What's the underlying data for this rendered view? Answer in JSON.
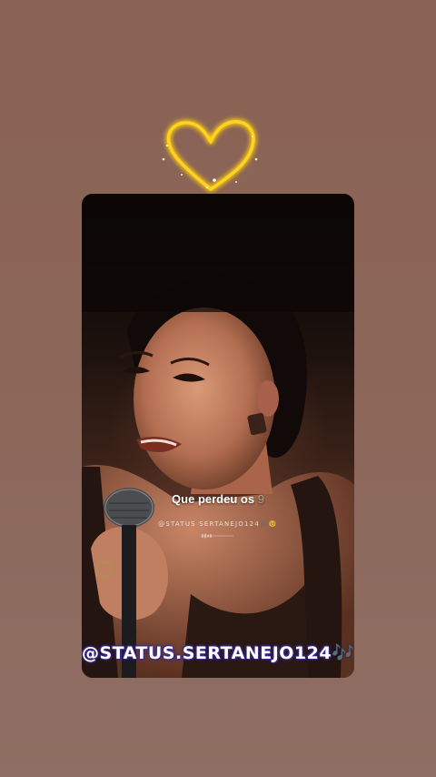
{
  "lyric": {
    "main": "Que perdeu os",
    "faded": "9"
  },
  "small_handle": "@STATUS SERTANEJO124",
  "small_emojis": "🎶🥺",
  "watermark": {
    "text": "@STATUS.SERTANEJO124",
    "icon": "music-notes-icon",
    "glyph": "🎶"
  },
  "colors": {
    "background": "#8b6557",
    "heart": "#ffd21a",
    "watermark_outline": "#3a2a8a",
    "music_note": "#7b3fd6"
  }
}
